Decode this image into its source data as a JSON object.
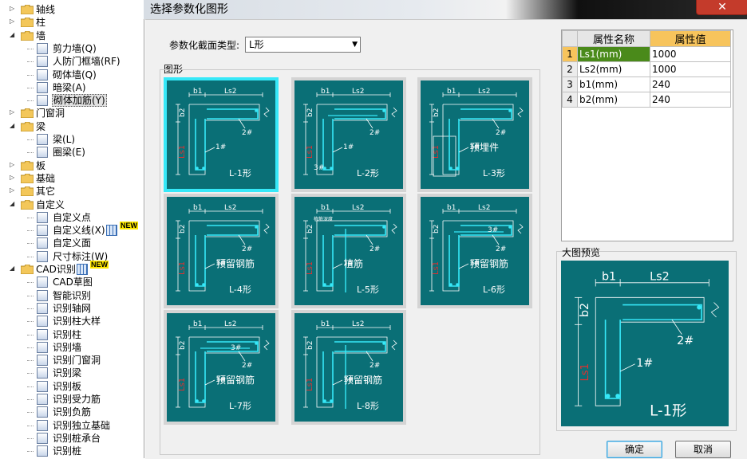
{
  "tree": {
    "items": [
      {
        "label": "轴线",
        "level": 0,
        "expand": "+",
        "icon": "folder-icon"
      },
      {
        "label": "柱",
        "level": 0,
        "expand": "+",
        "icon": "folder-icon"
      },
      {
        "label": "墙",
        "level": 0,
        "expand": "-",
        "icon": "folder-open-icon"
      },
      {
        "label": "剪力墙(Q)",
        "level": 1,
        "icon": "shear-wall-icon"
      },
      {
        "label": "人防门框墙(RF)",
        "level": 1,
        "icon": "civil-defense-wall-icon"
      },
      {
        "label": "砌体墙(Q)",
        "level": 1,
        "icon": "masonry-wall-icon"
      },
      {
        "label": "暗梁(A)",
        "level": 1,
        "icon": "hidden-beam-icon"
      },
      {
        "label": "砌体加筋(Y)",
        "level": 1,
        "icon": "masonry-rebar-icon",
        "selected": true
      },
      {
        "label": "门窗洞",
        "level": 0,
        "expand": "+",
        "icon": "folder-icon"
      },
      {
        "label": "梁",
        "level": 0,
        "expand": "-",
        "icon": "folder-open-icon"
      },
      {
        "label": "梁(L)",
        "level": 1,
        "icon": "beam-icon"
      },
      {
        "label": "圈梁(E)",
        "level": 1,
        "icon": "ring-beam-icon"
      },
      {
        "label": "板",
        "level": 0,
        "expand": "+",
        "icon": "folder-icon"
      },
      {
        "label": "基础",
        "level": 0,
        "expand": "+",
        "icon": "folder-icon"
      },
      {
        "label": "其它",
        "level": 0,
        "expand": "+",
        "icon": "folder-icon"
      },
      {
        "label": "自定义",
        "level": 0,
        "expand": "-",
        "icon": "folder-open-icon"
      },
      {
        "label": "自定义点",
        "level": 1,
        "icon": "custom-point-icon"
      },
      {
        "label": "自定义线(X)",
        "level": 1,
        "icon": "custom-line-icon",
        "badge": "NEW"
      },
      {
        "label": "自定义面",
        "level": 1,
        "icon": "custom-face-icon"
      },
      {
        "label": "尺寸标注(W)",
        "level": 1,
        "icon": "dimension-icon"
      },
      {
        "label": "CAD识别",
        "level": 0,
        "expand": "-",
        "icon": "folder-open-icon",
        "badge": "NEW"
      },
      {
        "label": "CAD草图",
        "level": 1,
        "icon": "cad-sketch-icon"
      },
      {
        "label": "智能识别",
        "level": 1,
        "icon": "smart-recognize-icon"
      },
      {
        "label": "识别轴网",
        "level": 1,
        "icon": "recognize-grid-icon"
      },
      {
        "label": "识别柱大样",
        "level": 1,
        "icon": "recognize-column-detail-icon"
      },
      {
        "label": "识别柱",
        "level": 1,
        "icon": "recognize-column-icon"
      },
      {
        "label": "识别墙",
        "level": 1,
        "icon": "recognize-wall-icon"
      },
      {
        "label": "识别门窗洞",
        "level": 1,
        "icon": "recognize-opening-icon"
      },
      {
        "label": "识别梁",
        "level": 1,
        "icon": "recognize-beam-icon"
      },
      {
        "label": "识别板",
        "level": 1,
        "icon": "recognize-slab-icon"
      },
      {
        "label": "识别受力筋",
        "level": 1,
        "icon": "recognize-main-rebar-icon"
      },
      {
        "label": "识别负筋",
        "level": 1,
        "icon": "recognize-negative-rebar-icon"
      },
      {
        "label": "识别独立基础",
        "level": 1,
        "icon": "recognize-isolated-footing-icon"
      },
      {
        "label": "识别桩承台",
        "level": 1,
        "icon": "recognize-pile-cap-icon"
      },
      {
        "label": "识别桩",
        "level": 1,
        "icon": "recognize-pile-icon"
      }
    ]
  },
  "dialog": {
    "title": "选择参数化图形",
    "close_glyph": "✕",
    "type_label": "参数化截面类型:",
    "type_value": "L形",
    "shape_group_label": "图形",
    "preview_label": "大图预览",
    "ok_label": "确定",
    "cancel_label": "取消"
  },
  "shapes": [
    {
      "name": "L-1形",
      "caption": "",
      "selected": true
    },
    {
      "name": "L-2形",
      "caption": ""
    },
    {
      "name": "L-3形",
      "caption": "预埋件"
    },
    {
      "name": "L-4形",
      "caption": "预留钢筋"
    },
    {
      "name": "L-5形",
      "caption": "植筋",
      "extra": "植筋深度"
    },
    {
      "name": "L-6形",
      "caption": "预留钢筋"
    },
    {
      "name": "L-7形",
      "caption": "预留钢筋"
    },
    {
      "name": "L-8形",
      "caption": "预留钢筋"
    }
  ],
  "shape_labels": {
    "ls1": "Ls1",
    "ls2": "Ls2",
    "b1": "b1",
    "b2": "b2",
    "r1": "1#",
    "r2": "2#",
    "r3": "3#"
  },
  "properties": {
    "headers": {
      "name": "属性名称",
      "value": "属性值"
    },
    "rows": [
      {
        "index": "1",
        "name": "Ls1(mm)",
        "value": "1000"
      },
      {
        "index": "2",
        "name": "Ls2(mm)",
        "value": "1000"
      },
      {
        "index": "3",
        "name": "b1(mm)",
        "value": "240"
      },
      {
        "index": "4",
        "name": "b2(mm)",
        "value": "240"
      }
    ]
  },
  "preview": {
    "shape": "L-1形"
  },
  "colors": {
    "teal": "#0a6f76",
    "cyan": "#36e8f8",
    "accent_orange": "#f7c45c",
    "selected_green": "#4a8a1a"
  }
}
